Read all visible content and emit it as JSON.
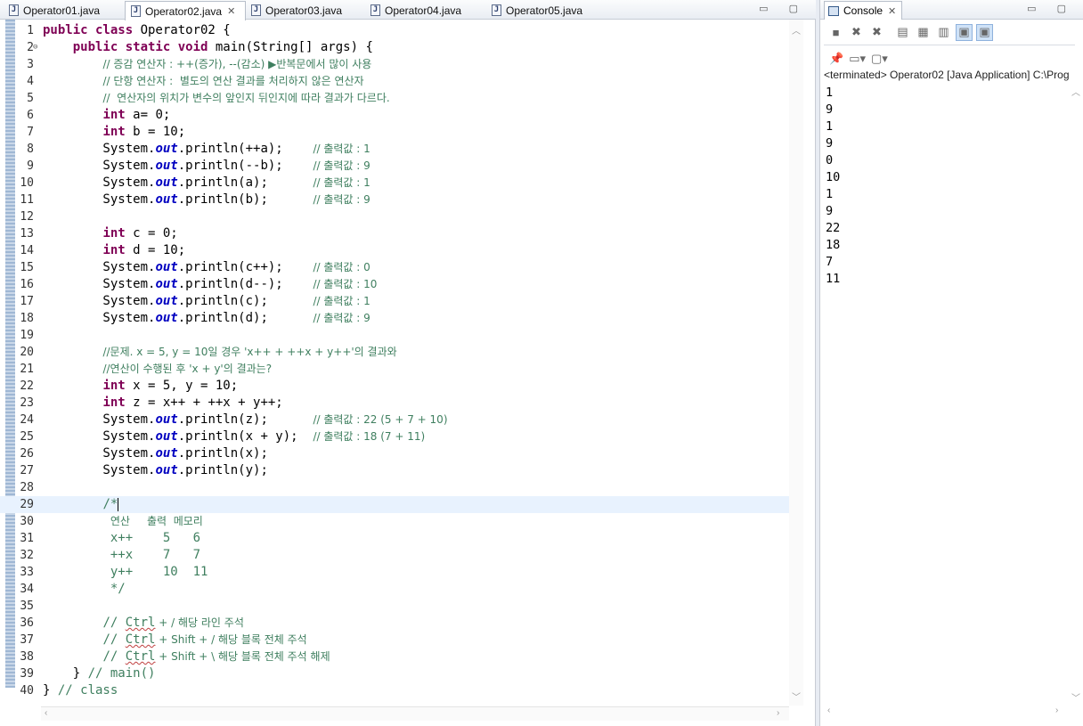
{
  "tabs": [
    {
      "label": "Operator01.java",
      "active": false
    },
    {
      "label": "Operator02.java",
      "active": true
    },
    {
      "label": "Operator03.java",
      "active": false
    },
    {
      "label": "Operator04.java",
      "active": false
    },
    {
      "label": "Operator05.java",
      "active": false
    }
  ],
  "code_lines": [
    {
      "num": "1",
      "segs": [
        [
          "kw",
          "public class "
        ],
        [
          "",
          "Operator02 {"
        ]
      ]
    },
    {
      "num": "2",
      "fold": true,
      "segs": [
        [
          "",
          "    "
        ],
        [
          "kw",
          "public static void "
        ],
        [
          "",
          "main(String[] args) {"
        ]
      ]
    },
    {
      "num": "3",
      "segs": [
        [
          "",
          "        "
        ],
        [
          "cm",
          "// 증감 연산자 : ++(증가), --(감소) ▶반복문에서 많이 사용"
        ]
      ]
    },
    {
      "num": "4",
      "segs": [
        [
          "",
          "        "
        ],
        [
          "cm",
          "// 단항 연산자 :  별도의 연산 결과를 처리하지 않은 연산자"
        ]
      ]
    },
    {
      "num": "5",
      "segs": [
        [
          "",
          "        "
        ],
        [
          "cm",
          "//  연산자의 위치가 변수의 앞인지 뒤인지에 따라 결과가 다르다."
        ]
      ]
    },
    {
      "num": "6",
      "segs": [
        [
          "",
          "        "
        ],
        [
          "kw",
          "int "
        ],
        [
          "",
          "a= 0;"
        ]
      ]
    },
    {
      "num": "7",
      "segs": [
        [
          "",
          "        "
        ],
        [
          "kw",
          "int "
        ],
        [
          "",
          "b = 10;"
        ]
      ]
    },
    {
      "num": "8",
      "segs": [
        [
          "",
          "        System."
        ],
        [
          "fld",
          "out"
        ],
        [
          "",
          ".println(++a);    "
        ],
        [
          "cm",
          "// 출력값 : 1"
        ]
      ]
    },
    {
      "num": "9",
      "segs": [
        [
          "",
          "        System."
        ],
        [
          "fld",
          "out"
        ],
        [
          "",
          ".println(--b);    "
        ],
        [
          "cm",
          "// 출력값 : 9"
        ]
      ]
    },
    {
      "num": "10",
      "segs": [
        [
          "",
          "        System."
        ],
        [
          "fld",
          "out"
        ],
        [
          "",
          ".println(a);      "
        ],
        [
          "cm",
          "// 출력값 : 1"
        ]
      ]
    },
    {
      "num": "11",
      "segs": [
        [
          "",
          "        System."
        ],
        [
          "fld",
          "out"
        ],
        [
          "",
          ".println(b);      "
        ],
        [
          "cm",
          "// 출력값 : 9"
        ]
      ]
    },
    {
      "num": "12",
      "segs": []
    },
    {
      "num": "13",
      "segs": [
        [
          "",
          "        "
        ],
        [
          "kw",
          "int "
        ],
        [
          "",
          "c = 0;"
        ]
      ]
    },
    {
      "num": "14",
      "segs": [
        [
          "",
          "        "
        ],
        [
          "kw",
          "int "
        ],
        [
          "",
          "d = 10;"
        ]
      ]
    },
    {
      "num": "15",
      "segs": [
        [
          "",
          "        System."
        ],
        [
          "fld",
          "out"
        ],
        [
          "",
          ".println(c++);    "
        ],
        [
          "cm",
          "// 출력값 : 0"
        ]
      ]
    },
    {
      "num": "16",
      "segs": [
        [
          "",
          "        System."
        ],
        [
          "fld",
          "out"
        ],
        [
          "",
          ".println(d--);    "
        ],
        [
          "cm",
          "// 출력값 : 10"
        ]
      ]
    },
    {
      "num": "17",
      "segs": [
        [
          "",
          "        System."
        ],
        [
          "fld",
          "out"
        ],
        [
          "",
          ".println(c);      "
        ],
        [
          "cm",
          "// 출력값 : 1"
        ]
      ]
    },
    {
      "num": "18",
      "segs": [
        [
          "",
          "        System."
        ],
        [
          "fld",
          "out"
        ],
        [
          "",
          ".println(d);      "
        ],
        [
          "cm",
          "// 출력값 : 9"
        ]
      ]
    },
    {
      "num": "19",
      "segs": []
    },
    {
      "num": "20",
      "segs": [
        [
          "",
          "        "
        ],
        [
          "cm",
          "//문제. x = 5, y = 10일 경우 'x++ + ++x + y++'의 결과와"
        ]
      ]
    },
    {
      "num": "21",
      "segs": [
        [
          "",
          "        "
        ],
        [
          "cm",
          "//연산이 수행된 후 'x + y'의 결과는?"
        ]
      ]
    },
    {
      "num": "22",
      "segs": [
        [
          "",
          "        "
        ],
        [
          "kw",
          "int "
        ],
        [
          "",
          "x = 5, y = 10;"
        ]
      ]
    },
    {
      "num": "23",
      "segs": [
        [
          "",
          "        "
        ],
        [
          "kw",
          "int "
        ],
        [
          "",
          "z = x++ + ++x + y++;"
        ]
      ]
    },
    {
      "num": "24",
      "segs": [
        [
          "",
          "        System."
        ],
        [
          "fld",
          "out"
        ],
        [
          "",
          ".println(z);      "
        ],
        [
          "cm",
          "// 출력값 : 22 (5 + 7 + 10)"
        ]
      ]
    },
    {
      "num": "25",
      "segs": [
        [
          "",
          "        System."
        ],
        [
          "fld",
          "out"
        ],
        [
          "",
          ".println(x + y);  "
        ],
        [
          "cm",
          "// 출력값 : 18 (7 + 11)"
        ]
      ]
    },
    {
      "num": "26",
      "segs": [
        [
          "",
          "        System."
        ],
        [
          "fld",
          "out"
        ],
        [
          "",
          ".println(x);"
        ]
      ]
    },
    {
      "num": "27",
      "segs": [
        [
          "",
          "        System."
        ],
        [
          "fld",
          "out"
        ],
        [
          "",
          ".println(y);"
        ]
      ]
    },
    {
      "num": "28",
      "segs": []
    },
    {
      "num": "29",
      "current": true,
      "segs": [
        [
          "",
          "        "
        ],
        [
          "cm",
          "/*"
        ]
      ]
    },
    {
      "num": "30",
      "segs": [
        [
          "",
          "         "
        ],
        [
          "cm",
          "연산     출력  메모리"
        ]
      ]
    },
    {
      "num": "31",
      "segs": [
        [
          "",
          "         "
        ],
        [
          "cm",
          "x++    5   6"
        ]
      ]
    },
    {
      "num": "32",
      "segs": [
        [
          "",
          "         "
        ],
        [
          "cm",
          "++x    7   7"
        ]
      ]
    },
    {
      "num": "33",
      "segs": [
        [
          "",
          "         "
        ],
        [
          "cm",
          "y++    10  11"
        ]
      ]
    },
    {
      "num": "34",
      "segs": [
        [
          "",
          "         "
        ],
        [
          "cm",
          "*/"
        ]
      ]
    },
    {
      "num": "35",
      "segs": []
    },
    {
      "num": "36",
      "segs": [
        [
          "",
          "        "
        ],
        [
          "cm",
          "// "
        ],
        [
          "cmsq",
          "Ctrl"
        ],
        [
          "cm",
          " + / 해당 라인 주석"
        ]
      ]
    },
    {
      "num": "37",
      "segs": [
        [
          "",
          "        "
        ],
        [
          "cm",
          "// "
        ],
        [
          "cmsq",
          "Ctrl"
        ],
        [
          "cm",
          " + Shift + / 해당 블록 전체 주석"
        ]
      ]
    },
    {
      "num": "38",
      "segs": [
        [
          "",
          "        "
        ],
        [
          "cm",
          "// "
        ],
        [
          "cmsq",
          "Ctrl"
        ],
        [
          "cm",
          " + Shift + \\ 해당 블록 전체 주석 해제"
        ]
      ]
    },
    {
      "num": "39",
      "segs": [
        [
          "",
          "    } "
        ],
        [
          "cm",
          "// main()"
        ]
      ]
    },
    {
      "num": "40",
      "segs": [
        [
          "",
          "} "
        ],
        [
          "cm",
          "// class"
        ]
      ]
    }
  ],
  "console": {
    "tab_label": "Console",
    "status": "<terminated> Operator02 [Java Application] C:\\Prog",
    "output": [
      "1",
      "9",
      "1",
      "9",
      "0",
      "10",
      "1",
      "9",
      "22",
      "18",
      "7",
      "11"
    ]
  }
}
